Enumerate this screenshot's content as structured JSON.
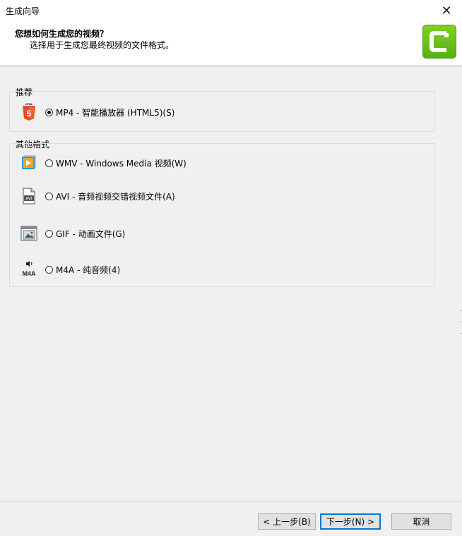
{
  "window": {
    "title": "生成向导",
    "close_symbol": "✕"
  },
  "header": {
    "title": "您想如何生成您的视频？",
    "subtitle": "选择用于生成您最终视频的文件格式。"
  },
  "groups": {
    "recommended": {
      "label": "推荐",
      "options": [
        {
          "label": "MP4 - 智能播放器 (HTML5)(S)",
          "icon": "html5-icon",
          "selected": true
        }
      ]
    },
    "other": {
      "label": "其他格式",
      "options": [
        {
          "label": "WMV - Windows Media 视频(W)",
          "icon": "windows-media-icon",
          "selected": false
        },
        {
          "label": "AVI - 音频视频交错视频文件(A)",
          "icon": "avi-file-icon",
          "selected": false
        },
        {
          "label": "GIF - 动画文件(G)",
          "icon": "gif-file-icon",
          "selected": false
        },
        {
          "label": "M4A - 纯音频(4)",
          "icon": "m4a-audio-icon",
          "selected": false
        }
      ]
    }
  },
  "icon_text": {
    "html5_top": "HTML",
    "html5_num": "5",
    "avi": "AVI",
    "m4a": "M4A"
  },
  "buttons": {
    "back": "< 上一步(B)",
    "next": "下一步(N) >",
    "cancel": "取消"
  },
  "colors": {
    "brand_green": "#5cb615",
    "html5_orange": "#e44d26",
    "wmv_blue": "#2d9cdb",
    "wmv_orange": "#f5a623",
    "primary_border": "#0078d7"
  }
}
